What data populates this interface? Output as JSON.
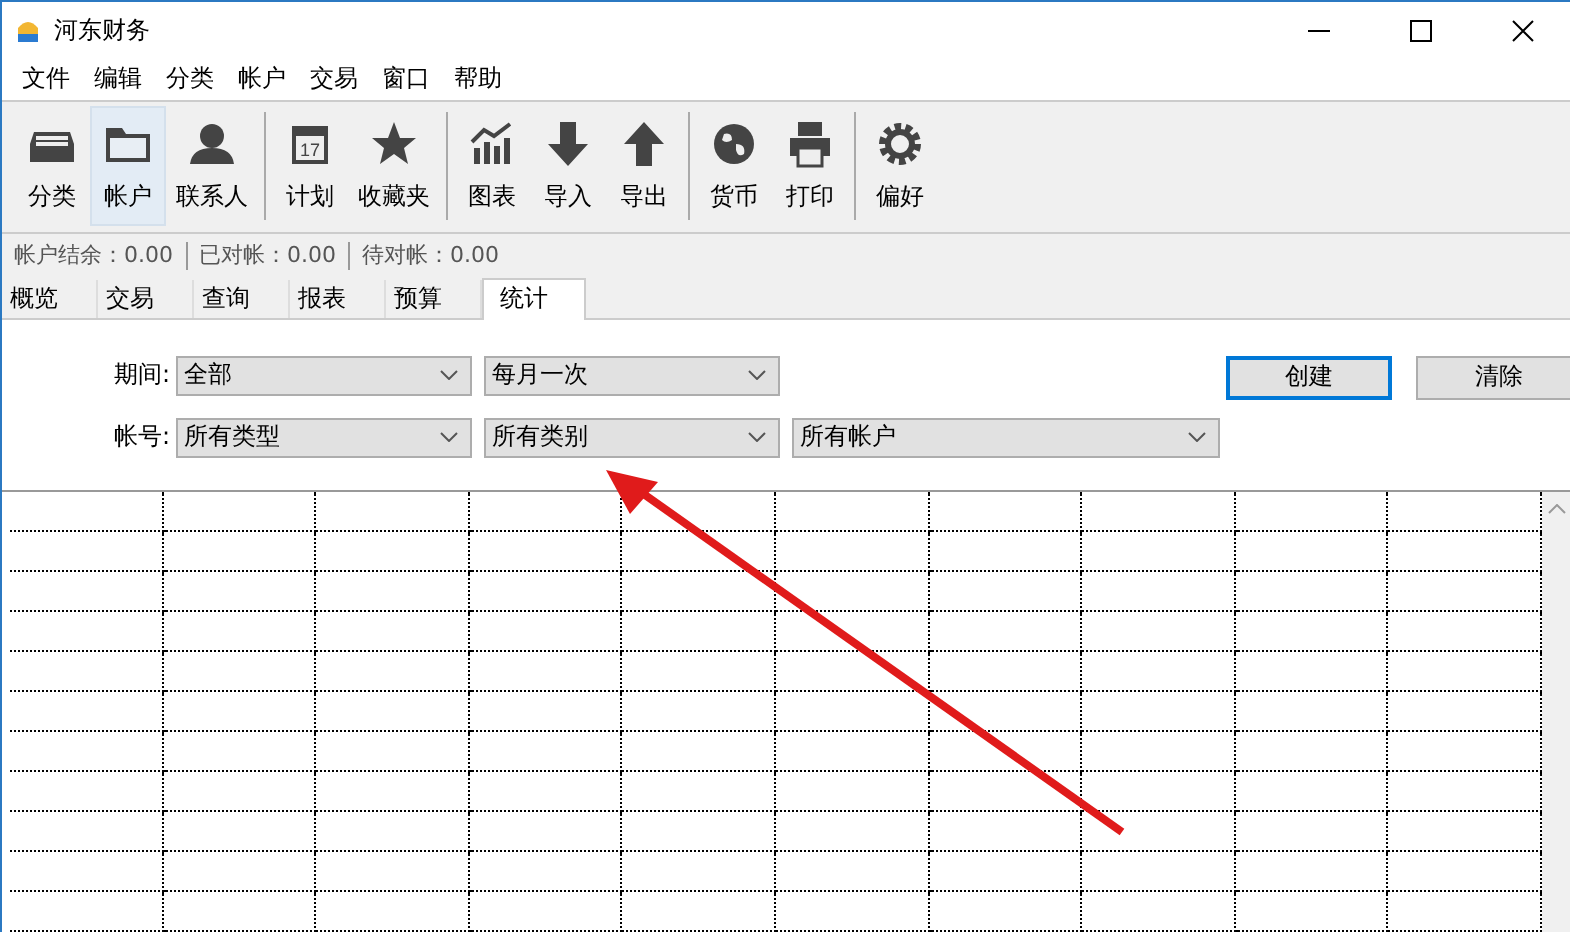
{
  "window": {
    "title": "河东财务"
  },
  "menu": [
    "文件",
    "编辑",
    "分类",
    "帐户",
    "交易",
    "窗口",
    "帮助"
  ],
  "toolbar_groups": [
    [
      {
        "label": "分类",
        "selected": false
      },
      {
        "label": "帐户",
        "selected": true
      },
      {
        "label": "联系人",
        "selected": false
      }
    ],
    [
      {
        "label": "计划",
        "selected": false,
        "icon_text": "17"
      },
      {
        "label": "收藏夹",
        "selected": false
      }
    ],
    [
      {
        "label": "图表",
        "selected": false
      },
      {
        "label": "导入",
        "selected": false
      },
      {
        "label": "导出",
        "selected": false
      }
    ],
    [
      {
        "label": "货币",
        "selected": false
      },
      {
        "label": "打印",
        "selected": false
      }
    ],
    [
      {
        "label": "偏好",
        "selected": false
      }
    ]
  ],
  "balances": [
    "帐户结余：0.00",
    "已对帐：0.00",
    "待对帐：0.00"
  ],
  "tabs": [
    {
      "label": "概览",
      "selected": false
    },
    {
      "label": "交易",
      "selected": false
    },
    {
      "label": "查询",
      "selected": false
    },
    {
      "label": "报表",
      "selected": false
    },
    {
      "label": "预算",
      "selected": false
    },
    {
      "label": "统计",
      "selected": true
    }
  ],
  "filters": [
    {
      "label": "期间:",
      "dropdowns": [
        "全部",
        "每月一次"
      ]
    },
    {
      "label": "帐号:",
      "dropdowns": [
        "所有类型",
        "所有类别",
        "所有帐户"
      ]
    }
  ],
  "buttons": [
    {
      "label": "创建",
      "focused": true
    },
    {
      "label": "清除",
      "focused": false
    }
  ]
}
